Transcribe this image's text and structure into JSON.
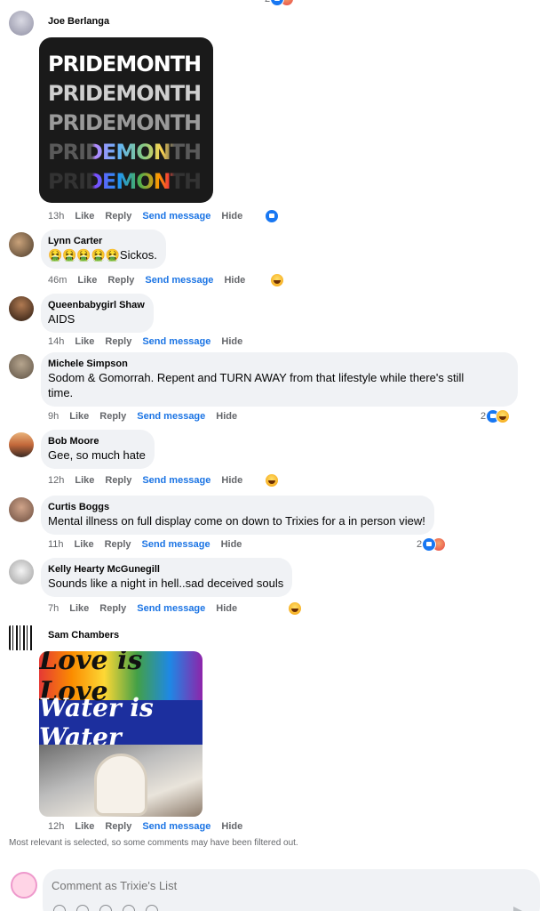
{
  "top_partial": {
    "reaction_count": "2"
  },
  "comments": [
    {
      "name": "Joe Berlanga",
      "time": "13h",
      "like": "Like",
      "reply": "Reply",
      "send": "Send message",
      "hide": "Hide",
      "image_lines": [
        "PRIDEMONTH",
        "PRIDEMONTH",
        "PRIDEMONTH",
        "PRIDEMONTH",
        "PRIDEMONTH"
      ]
    },
    {
      "name": "Lynn Carter",
      "text": "🤮🤮🤮🤮🤮Sickos.",
      "time": "46m",
      "like": "Like",
      "reply": "Reply",
      "send": "Send message",
      "hide": "Hide"
    },
    {
      "name": "Queenbabygirl Shaw",
      "text": "AIDS",
      "time": "14h",
      "like": "Like",
      "reply": "Reply",
      "send": "Send message",
      "hide": "Hide"
    },
    {
      "name": "Michele Simpson",
      "text_line1": "Sodom & Gomorrah. Repent and TURN AWAY from that lifestyle while there's still",
      "text_line2": "time.",
      "time": "9h",
      "like": "Like",
      "reply": "Reply",
      "send": "Send message",
      "hide": "Hide",
      "reaction_count": "2"
    },
    {
      "name": "Bob Moore",
      "text": "Gee, so much hate",
      "time": "12h",
      "like": "Like",
      "reply": "Reply",
      "send": "Send message",
      "hide": "Hide"
    },
    {
      "name": "Curtis Boggs",
      "text": "Mental illness on full display come on down to Trixies for a in person view!",
      "time": "11h",
      "like": "Like",
      "reply": "Reply",
      "send": "Send message",
      "hide": "Hide",
      "reaction_count": "2"
    },
    {
      "name": "Kelly Hearty McGunegill",
      "text": "Sounds like a night in hell..sad deceived souls",
      "time": "7h",
      "like": "Like",
      "reply": "Reply",
      "send": "Send message",
      "hide": "Hide"
    },
    {
      "name": "Sam Chambers",
      "time": "12h",
      "like": "Like",
      "reply": "Reply",
      "send": "Send message",
      "hide": "Hide",
      "image_line1": "Love is Love",
      "image_line2": "Water is Water"
    }
  ],
  "filter_note": "Most relevant is selected, so some comments may have been filtered out.",
  "composer": {
    "placeholder": "Comment as Trixie's List"
  },
  "colors": {
    "link": "#1b74e4",
    "bubble": "#f0f2f5",
    "meta": "#65676b"
  }
}
